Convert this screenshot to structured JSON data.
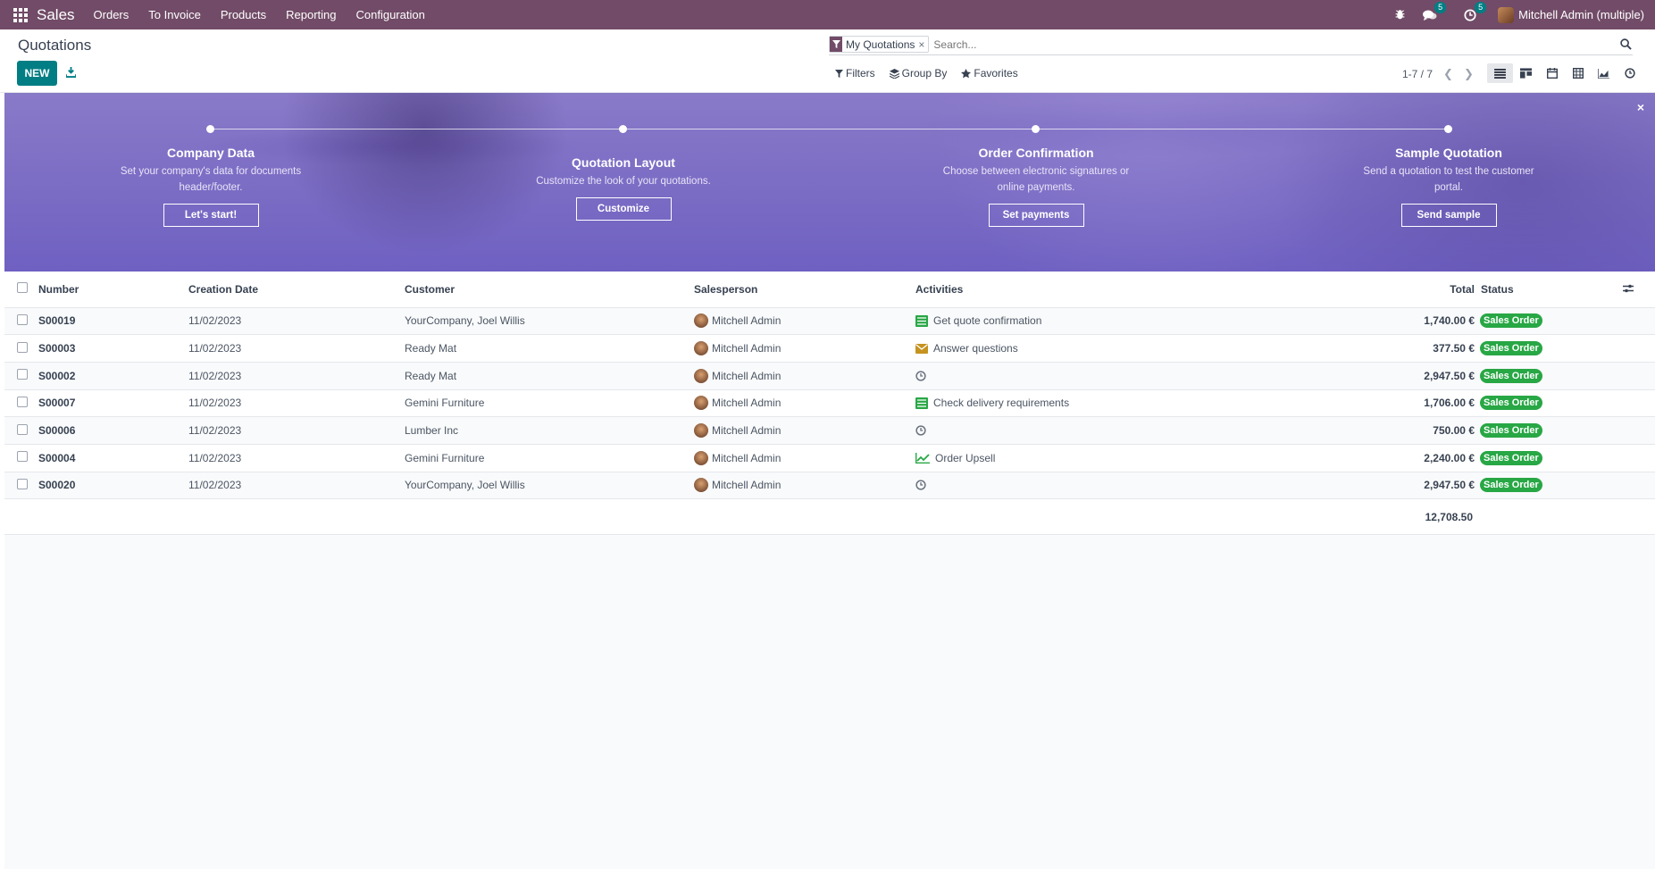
{
  "navbar": {
    "app_name": "Sales",
    "menu": [
      "Orders",
      "To Invoice",
      "Products",
      "Reporting",
      "Configuration"
    ],
    "messages_count": "5",
    "activities_count": "5",
    "user": "Mitchell Admin (multiple)"
  },
  "control": {
    "title": "Quotations",
    "new_label": "NEW",
    "facet": "My Quotations",
    "facet_close": "×",
    "search_placeholder": "Search...",
    "filters": "Filters",
    "group_by": "Group By",
    "favorites": "Favorites",
    "pager": "1-7 / 7"
  },
  "banner": {
    "close": "×",
    "steps": [
      {
        "title": "Company Data",
        "desc": "Set your company's data for documents header/footer.",
        "button": "Let's start!"
      },
      {
        "title": "Quotation Layout",
        "desc": "Customize the look of your quotations.",
        "button": "Customize"
      },
      {
        "title": "Order Confirmation",
        "desc": "Choose between electronic signatures or online payments.",
        "button": "Set payments"
      },
      {
        "title": "Sample Quotation",
        "desc": "Send a quotation to test the customer portal.",
        "button": "Send sample"
      }
    ]
  },
  "table": {
    "headers": {
      "number": "Number",
      "date": "Creation Date",
      "customer": "Customer",
      "salesperson": "Salesperson",
      "activities": "Activities",
      "total": "Total",
      "status": "Status"
    },
    "rows": [
      {
        "number": "S00019",
        "date": "11/02/2023",
        "customer": "YourCompany, Joel Willis",
        "salesperson": "Mitchell Admin",
        "activity_icon": "task-list-icon",
        "activity": "Get quote confirmation",
        "total": "1,740.00 €",
        "status": "Sales Order"
      },
      {
        "number": "S00003",
        "date": "11/02/2023",
        "customer": "Ready Mat",
        "salesperson": "Mitchell Admin",
        "activity_icon": "envelope-icon",
        "activity": "Answer questions",
        "total": "377.50 €",
        "status": "Sales Order"
      },
      {
        "number": "S00002",
        "date": "11/02/2023",
        "customer": "Ready Mat",
        "salesperson": "Mitchell Admin",
        "activity_icon": "clock-icon",
        "activity": "",
        "total": "2,947.50 €",
        "status": "Sales Order"
      },
      {
        "number": "S00007",
        "date": "11/02/2023",
        "customer": "Gemini Furniture",
        "salesperson": "Mitchell Admin",
        "activity_icon": "task-list-icon",
        "activity": "Check delivery requirements",
        "total": "1,706.00 €",
        "status": "Sales Order"
      },
      {
        "number": "S00006",
        "date": "11/02/2023",
        "customer": "Lumber Inc",
        "salesperson": "Mitchell Admin",
        "activity_icon": "clock-icon",
        "activity": "",
        "total": "750.00 €",
        "status": "Sales Order"
      },
      {
        "number": "S00004",
        "date": "11/02/2023",
        "customer": "Gemini Furniture",
        "salesperson": "Mitchell Admin",
        "activity_icon": "line-chart-icon",
        "activity": "Order Upsell",
        "total": "2,240.00 €",
        "status": "Sales Order"
      },
      {
        "number": "S00020",
        "date": "11/02/2023",
        "customer": "YourCompany, Joel Willis",
        "salesperson": "Mitchell Admin",
        "activity_icon": "clock-icon",
        "activity": "",
        "total": "2,947.50 €",
        "status": "Sales Order"
      }
    ],
    "grand_total": "12,708.50"
  },
  "colors": {
    "brand": "#714b67",
    "primary": "#017e84",
    "success": "#28a745",
    "banner": "#6f5fc0"
  }
}
